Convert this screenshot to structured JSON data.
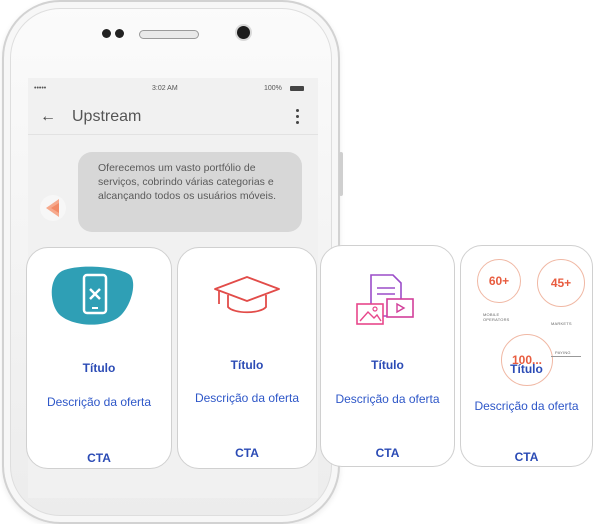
{
  "status_bar": {
    "signal": "•••••",
    "time": "3:02 AM",
    "battery": "100%"
  },
  "header": {
    "title": "Upstream"
  },
  "chat": {
    "message": "Oferecemos um vasto portfólio de serviços, cobrindo várias categorias e alcançando todos os usuários móveis."
  },
  "cards": [
    {
      "title": "Título",
      "description": "Descrição da oferta",
      "cta": "CTA",
      "icon": "mobile-cancel-icon"
    },
    {
      "title": "Título",
      "description": "Descrição da oferta",
      "cta": "CTA",
      "icon": "graduation-cap-icon"
    },
    {
      "title": "Título",
      "description": "Descrição da oferta",
      "cta": "CTA",
      "icon": "media-documents-icon"
    },
    {
      "title": "Título",
      "description": "Descrição da oferta",
      "cta": "CTA",
      "icon": "stats-infographic",
      "stats": [
        {
          "value": "60+",
          "caption": "MOBILE OPERATORS"
        },
        {
          "value": "45+",
          "caption": "MARKETS"
        },
        {
          "value": "100...",
          "caption": "PAYING"
        }
      ]
    }
  ],
  "colors": {
    "accent": "#2b4bb5",
    "teal": "#2f9fb5",
    "coral": "#e85c3f",
    "screen_bg": "#f1f1f1",
    "bubble": "#d7d7d7"
  }
}
